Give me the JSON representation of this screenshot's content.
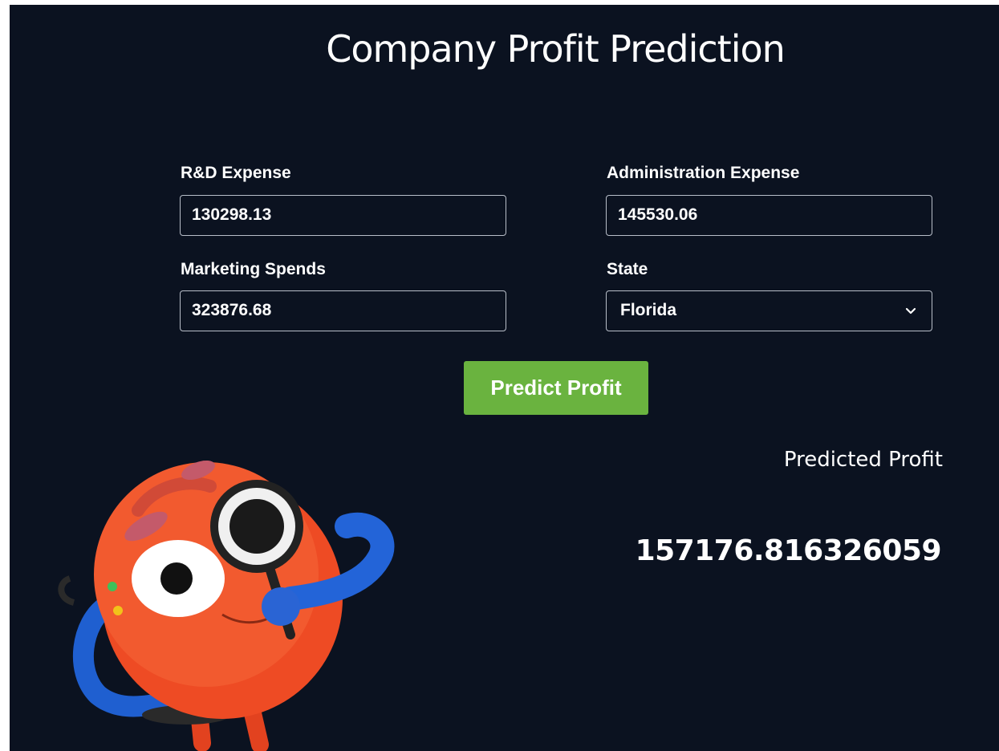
{
  "page": {
    "title": "Company Profit Prediction"
  },
  "form": {
    "rd_expense": {
      "label": "R&D Expense",
      "value": "130298.13"
    },
    "admin_expense": {
      "label": "Administration Expense",
      "value": "145530.06"
    },
    "marketing_spends": {
      "label": "Marketing Spends",
      "value": "323876.68"
    },
    "state": {
      "label": "State",
      "value": "Florida"
    },
    "predict_button": "Predict Profit"
  },
  "result": {
    "label": "Predicted Profit",
    "value": "157176.816326059"
  },
  "colors": {
    "background": "#0b1220",
    "button": "#6ab33f",
    "text": "#ffffff"
  }
}
